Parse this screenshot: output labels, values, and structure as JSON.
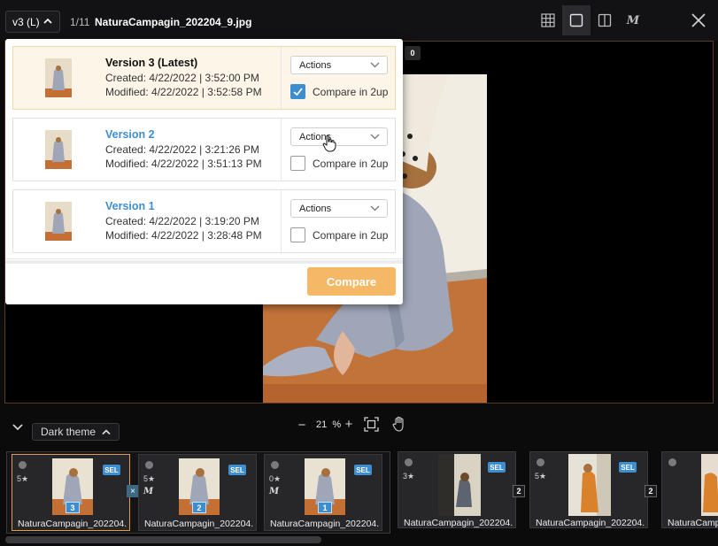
{
  "topbar": {
    "version_select": "v3 (L)",
    "counter": "1/11",
    "filename": "NaturaCampagin_202204_9.jpg",
    "view_buttons": [
      "grid-view-icon",
      "single-view-icon",
      "compare-view-icon",
      "markup-icon"
    ],
    "active_view": "single-view-icon"
  },
  "viewer": {
    "badge": "0"
  },
  "versions_popup": {
    "versions": [
      {
        "title": "Version 3 (Latest)",
        "created": "Created: 4/22/2022 | 3:52:00 PM",
        "modified": "Modified: 4/22/2022 | 3:52:58 PM",
        "actions_label": "Actions",
        "compare_label": "Compare in 2up",
        "compare_checked": true
      },
      {
        "title": "Version 2",
        "created": "Created: 4/22/2022 | 3:21:26 PM",
        "modified": "Modified: 4/22/2022 | 3:51:13 PM",
        "actions_label": "Actions",
        "compare_label": "Compare in 2up",
        "compare_checked": false
      },
      {
        "title": "Version 1",
        "created": "Created: 4/22/2022 | 3:19:20 PM",
        "modified": "Modified: 4/22/2022 | 3:28:48 PM",
        "actions_label": "Actions",
        "compare_label": "Compare in 2up",
        "compare_checked": false
      }
    ],
    "compare_button": "Compare"
  },
  "controls": {
    "theme_label": "Dark theme",
    "zoom_minus": "−",
    "zoom_value": "21",
    "zoom_unit": "%",
    "zoom_plus": "+"
  },
  "filmstrip": {
    "stack_cards": [
      {
        "rating": "5★",
        "stamp": "",
        "sel": "SEL",
        "version": "3",
        "name": "NaturaCampagin_202204..."
      },
      {
        "rating": "5★",
        "stamp": "M",
        "sel": "SEL",
        "version": "2",
        "name": "NaturaCampagin_202204..."
      },
      {
        "rating": "0★",
        "stamp": "M",
        "sel": "SEL",
        "version": "1",
        "name": "NaturaCampagin_202204..."
      }
    ],
    "unstack_label": "×",
    "other_cards": [
      {
        "rating": "3★",
        "sel": "SEL",
        "count": "2",
        "name": "NaturaCampagin_202204..."
      },
      {
        "rating": "5★",
        "sel": "SEL",
        "count": "2",
        "name": "NaturaCampagin_202204..."
      },
      {
        "rating": "",
        "sel": "",
        "count": "",
        "name": "NaturaCampag"
      }
    ]
  }
}
